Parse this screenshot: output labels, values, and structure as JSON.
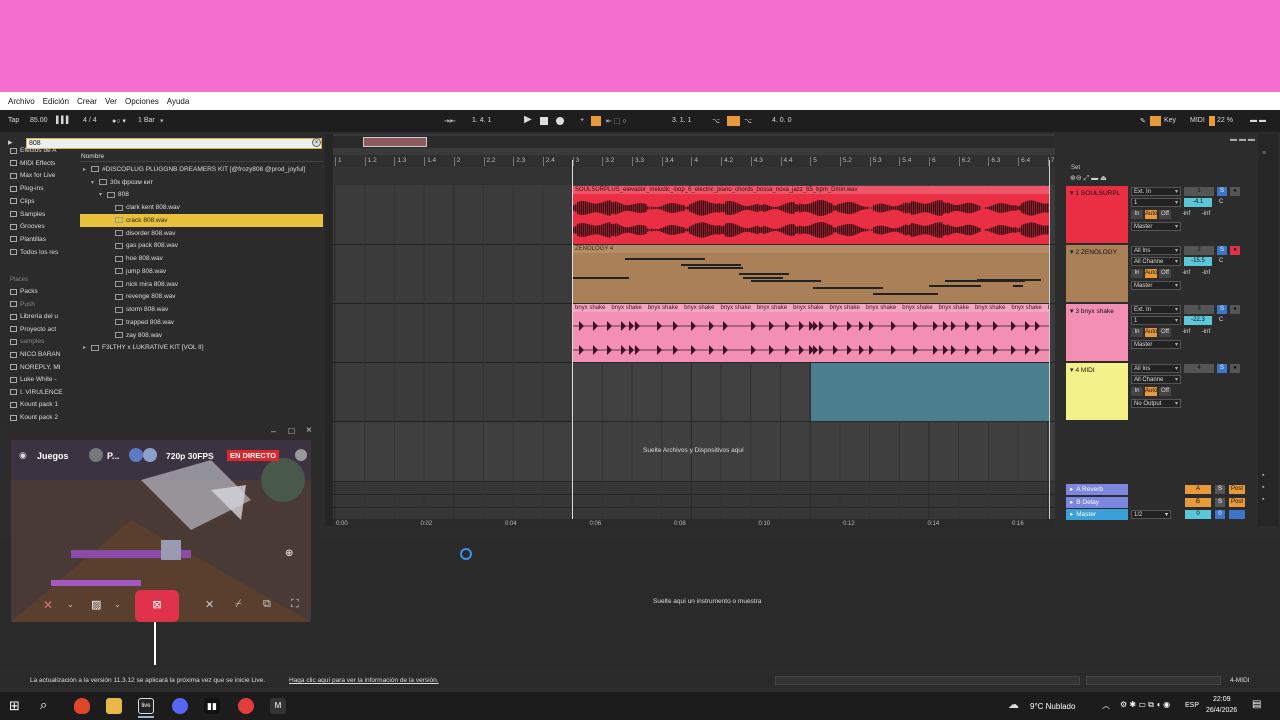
{
  "menu": [
    "Archivo",
    "Edición",
    "Crear",
    "Ver",
    "Opciones",
    "Ayuda"
  ],
  "transport": {
    "tap": "Tap",
    "tempo": "85.00",
    "sig": "4 / 4",
    "quant": "1 Bar",
    "pos": "1.   4.   1",
    "loop_start": "3.   1.   1",
    "loop_len": "4.   0.   0",
    "key": "Key",
    "midi": "MIDI",
    "cpu": "22 %"
  },
  "browser": {
    "search": "808",
    "header": "Nombre",
    "categories": [
      {
        "label": "Efectos de A"
      },
      {
        "label": "MIDI Effects"
      },
      {
        "label": "Max for Live"
      },
      {
        "label": "Plug-ins"
      },
      {
        "label": "Clips"
      },
      {
        "label": "Samples"
      },
      {
        "label": "Grooves"
      },
      {
        "label": "Plantillas"
      },
      {
        "label": "Todos los res"
      }
    ],
    "places_title": "Places",
    "places": [
      {
        "label": "Packs",
        "dim": false
      },
      {
        "label": "Push",
        "dim": true
      },
      {
        "label": "Librería del u",
        "dim": false
      },
      {
        "label": "Proyecto act",
        "dim": false
      },
      {
        "label": "samples",
        "dim": true
      },
      {
        "label": "NICO BARAN",
        "dim": false
      },
      {
        "label": "NOREPLY, MI",
        "dim": false
      },
      {
        "label": "Luke White -",
        "dim": false
      },
      {
        "label": "I. VIRULENCE",
        "dim": false
      },
      {
        "label": "Kount pack 1",
        "dim": false
      },
      {
        "label": "Kount pack 2",
        "dim": false
      }
    ],
    "files": [
      {
        "label": "#DISCOPLUG PLUGGNB DREAMERS KIT [@frozy808 @prod_joyful]",
        "indent": 0,
        "arrow": "▸"
      },
      {
        "label": "30к фрозм кит",
        "indent": 1,
        "arrow": "▾"
      },
      {
        "label": "808",
        "indent": 2,
        "arrow": "▾"
      },
      {
        "label": "clark kent 808.wav",
        "indent": 3,
        "arrow": ""
      },
      {
        "label": "crack 808.wav",
        "indent": 3,
        "arrow": "",
        "sel": true
      },
      {
        "label": "disorder 808.wav",
        "indent": 3,
        "arrow": ""
      },
      {
        "label": "gas pack 808.wav",
        "indent": 3,
        "arrow": ""
      },
      {
        "label": "hoe 808.wav",
        "indent": 3,
        "arrow": ""
      },
      {
        "label": "jump 808.wav",
        "indent": 3,
        "arrow": ""
      },
      {
        "label": "nick mira 808.wav",
        "indent": 3,
        "arrow": ""
      },
      {
        "label": "revenge 808.wav",
        "indent": 3,
        "arrow": ""
      },
      {
        "label": "storm 808.wav",
        "indent": 3,
        "arrow": ""
      },
      {
        "label": "trapped 808.wav",
        "indent": 3,
        "arrow": ""
      },
      {
        "label": "zay 808.wav",
        "indent": 3,
        "arrow": ""
      },
      {
        "label": "F3LTHY x LUKRATIVE KIT [VOL II]",
        "indent": 0,
        "arrow": "▸"
      }
    ]
  },
  "ruler": [
    "1",
    "1.2",
    "1.3",
    "1.4",
    "2",
    "2.2",
    "2.3",
    "2.4",
    "3",
    "3.2",
    "3.3",
    "3.4",
    "4",
    "4.2",
    "4.3",
    "4.4",
    "5",
    "5.2",
    "5.3",
    "5.4",
    "6",
    "6.2",
    "6.3",
    "6.4",
    "7"
  ],
  "time_ruler": [
    "0:00",
    "0:02",
    "0:04",
    "0:06",
    "0:08",
    "0:10",
    "0:12",
    "0:14",
    "0:16"
  ],
  "clips": {
    "c1": "SOULSURPLUS_elevador_melodic_loop_6_electric_piano_chords_bossa_nova_jazz_65_bpm_Dmin.wav",
    "c2": "ZENOLOGY 4",
    "c3": "bnyx shake"
  },
  "drop_arr": "Suelte Archivos y Dispositivos aquí",
  "tracks": [
    {
      "name": "1 SOULSURPL",
      "color": "#ea2f44",
      "in": "Ext. In",
      "ch": "1",
      "out": "Master",
      "vol": "-4.1",
      "pan": "C",
      "a": "-inf",
      "b": "-inf",
      "num": "1"
    },
    {
      "name": "2 ZENOLOGY",
      "color": "#a98058",
      "in": "All Ins",
      "ch": "All Channe",
      "out": "Master",
      "vol": "-15.5",
      "pan": "C",
      "a": "-inf",
      "b": "-inf",
      "num": "2"
    },
    {
      "name": "3 bnyx shake",
      "color": "#f38fb2",
      "in": "Ext. In",
      "ch": "1",
      "out": "Master",
      "vol": "-22.3",
      "pan": "C",
      "a": "-inf",
      "b": "-inf",
      "num": "3"
    },
    {
      "name": "4 MIDI",
      "color": "#f3f28a",
      "in": "All Ins",
      "ch": "All Channe",
      "out": "No Output",
      "num": "4"
    }
  ],
  "returns": [
    {
      "name": "A Reverb",
      "letter": "A"
    },
    {
      "name": "B Delay",
      "letter": "B"
    },
    {
      "name": "Master",
      "letter": "0"
    }
  ],
  "master_io": "1/2",
  "set_label": "Set",
  "drop_detail": "Suelte aquí un instrumento o muestra",
  "status": {
    "msg": "La actualización a la versión 11.3.12 se aplicará la próxima vez que se inicie Live.",
    "link": "Haga clic aquí para ver la información de la versión.",
    "right": "4-MIDI"
  },
  "stream": {
    "game": "Juegos",
    "user": "P...",
    "quality": "720p 30FPS",
    "live": "EN DIRECTO"
  },
  "tray": {
    "weather": "9°C  Nublado",
    "lang": "ESP",
    "time": "22:09",
    "date": "26/4/2026"
  },
  "colors": {
    "pink": "#f46fcd",
    "accent": "#e8c13a"
  }
}
